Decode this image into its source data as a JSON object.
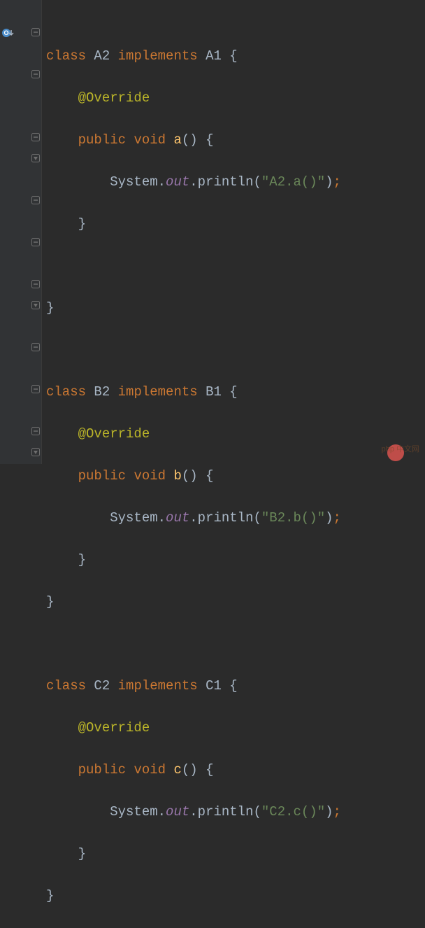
{
  "gutter": {
    "override_marker": "⬇"
  },
  "code": {
    "classA": {
      "kw_class": "class",
      "name": "A2",
      "kw_impl": "implements",
      "iface": "A1",
      "annotation": "@Override",
      "kw_public": "public",
      "kw_void": "void",
      "method": "a",
      "stmt_cls": "System",
      "stmt_field": "out",
      "stmt_call": "println",
      "stmt_arg": "\"A2.a()\""
    },
    "classB": {
      "kw_class": "class",
      "name": "B2",
      "kw_impl": "implements",
      "iface": "B1",
      "annotation": "@Override",
      "kw_public": "public",
      "kw_void": "void",
      "method": "b",
      "stmt_cls": "System",
      "stmt_field": "out",
      "stmt_call": "println",
      "stmt_arg": "\"B2.b()\""
    },
    "classC": {
      "kw_class": "class",
      "name": "C2",
      "kw_impl": "implements",
      "iface": "C1",
      "annotation": "@Override",
      "kw_public": "public",
      "kw_void": "void",
      "method": "c",
      "stmt_cls": "System",
      "stmt_field": "out",
      "stmt_call": "println",
      "stmt_arg": "\"C2.c()\""
    }
  },
  "watermark": "php 中文网"
}
